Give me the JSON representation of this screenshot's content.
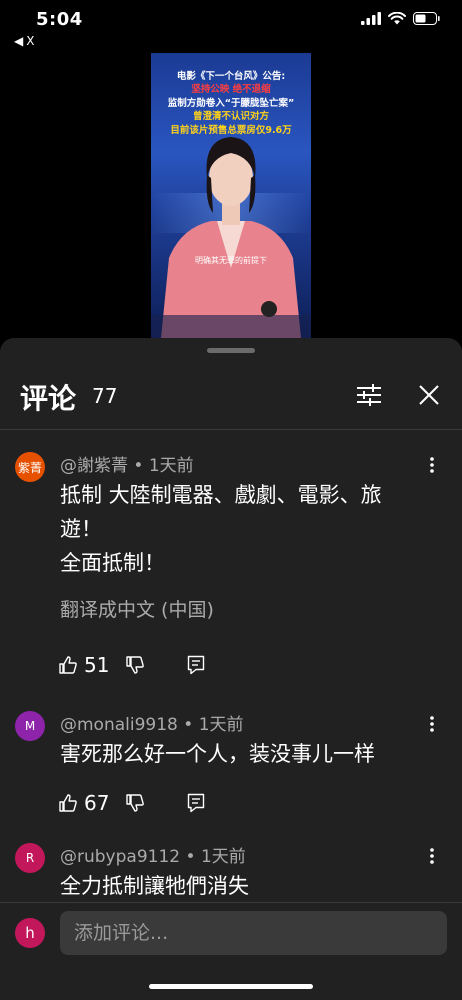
{
  "status": {
    "time": "5:04",
    "back_label": "X"
  },
  "video": {
    "captions": [
      "电影《下一个台风》公告:",
      "坚持公映 绝不退缩",
      "监制方勋卷入“于朦胧坠亡案”",
      "曾澄清不认识对方",
      "目前该片预售总票房仅9.6万"
    ],
    "subtitle": "明确其无罪的前提下"
  },
  "sheet": {
    "title": "评论",
    "count": "77"
  },
  "comments": [
    {
      "avatar_text": "紫菁",
      "avatar_color": "#e65100",
      "author": "@謝紫菁",
      "time": "1天前",
      "lines": [
        "抵制 大陸制電器、戲劇、電影、旅",
        "遊！",
        "全面抵制！"
      ],
      "translate_label": "翻译成中文 (中国)",
      "likes": "51"
    },
    {
      "avatar_text": "M",
      "avatar_color": "#8e24aa",
      "author": "@monali9918",
      "time": "1天前",
      "lines": [
        "害死那么好一个人，装没事儿一样"
      ],
      "likes": "67"
    },
    {
      "avatar_text": "R",
      "avatar_color": "#c2185b",
      "author": "@rubypa9112",
      "time": "1天前",
      "lines": [
        "全力抵制讓牠們消失"
      ]
    }
  ],
  "composer": {
    "avatar_text": "h",
    "placeholder": "添加评论..."
  }
}
